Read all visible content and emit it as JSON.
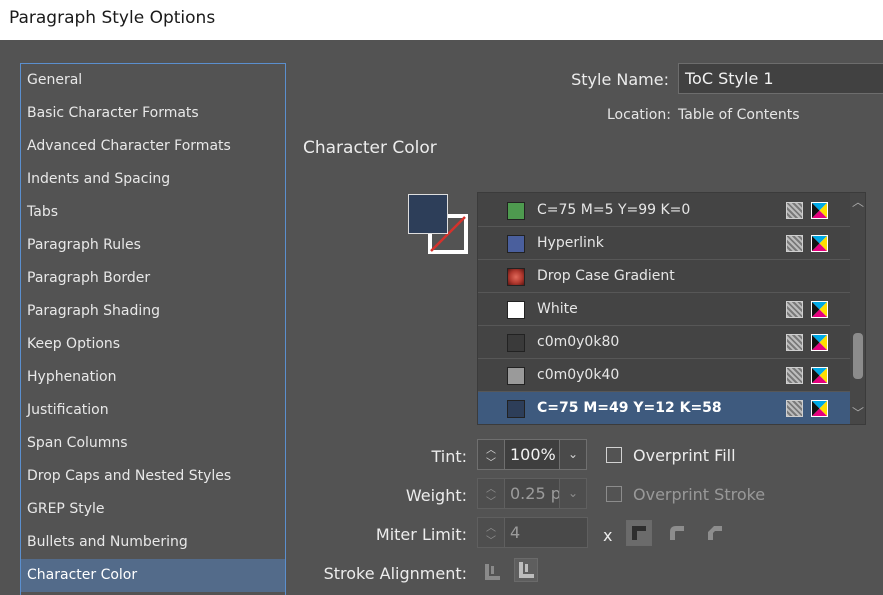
{
  "window": {
    "title": "Paragraph Style Options"
  },
  "sidebar": {
    "items": [
      {
        "label": "General"
      },
      {
        "label": "Basic Character Formats"
      },
      {
        "label": "Advanced Character Formats"
      },
      {
        "label": "Indents and Spacing"
      },
      {
        "label": "Tabs"
      },
      {
        "label": "Paragraph Rules"
      },
      {
        "label": "Paragraph Border"
      },
      {
        "label": "Paragraph Shading"
      },
      {
        "label": "Keep Options"
      },
      {
        "label": "Hyphenation"
      },
      {
        "label": "Justification"
      },
      {
        "label": "Span Columns"
      },
      {
        "label": "Drop Caps and Nested Styles"
      },
      {
        "label": "GREP Style"
      },
      {
        "label": "Bullets and Numbering"
      },
      {
        "label": "Character Color"
      }
    ],
    "selected": "Character Color"
  },
  "header": {
    "style_name_label": "Style Name:",
    "style_name_value": "ToC Style 1",
    "location_label": "Location:",
    "location_value": "Table of Contents"
  },
  "section": {
    "title": "Character Color"
  },
  "swatch": {
    "fill_color": "#2d3e59",
    "stroke": "none"
  },
  "swatches": [
    {
      "name": "C=75 M=5 Y=99 K=0",
      "color": "#4e9a4f",
      "icons": true,
      "selected": false
    },
    {
      "name": "Hyperlink",
      "color": "#4a5f9d",
      "icons": true,
      "selected": false
    },
    {
      "name": "Drop Case Gradient",
      "color": "#b0382e",
      "icons": false,
      "gradient": true,
      "selected": false
    },
    {
      "name": "White",
      "color": "#ffffff",
      "icons": true,
      "selected": false
    },
    {
      "name": "c0m0y0k80",
      "color": "#3a3a3a",
      "icons": true,
      "selected": false
    },
    {
      "name": "c0m0y0k40",
      "color": "#9a9a9a",
      "icons": true,
      "selected": false
    },
    {
      "name": "C=75 M=49 Y=12 K=58",
      "color": "#2d3e59",
      "icons": true,
      "selected": true
    }
  ],
  "controls": {
    "tint_label": "Tint:",
    "tint_value": "100%",
    "weight_label": "Weight:",
    "weight_value": "0.25 p",
    "miter_label": "Miter Limit:",
    "miter_value": "4",
    "miter_x": "x",
    "stroke_alignment_label": "Stroke Alignment:",
    "overprint_fill_label": "Overprint Fill",
    "overprint_fill_checked": false,
    "overprint_stroke_label": "Overprint Stroke",
    "overprint_stroke_checked": false
  },
  "colors": {
    "background": "#535353",
    "selection": "#536b8a",
    "list_selection": "#3e5a7e",
    "accent_border": "#5b8fce"
  }
}
